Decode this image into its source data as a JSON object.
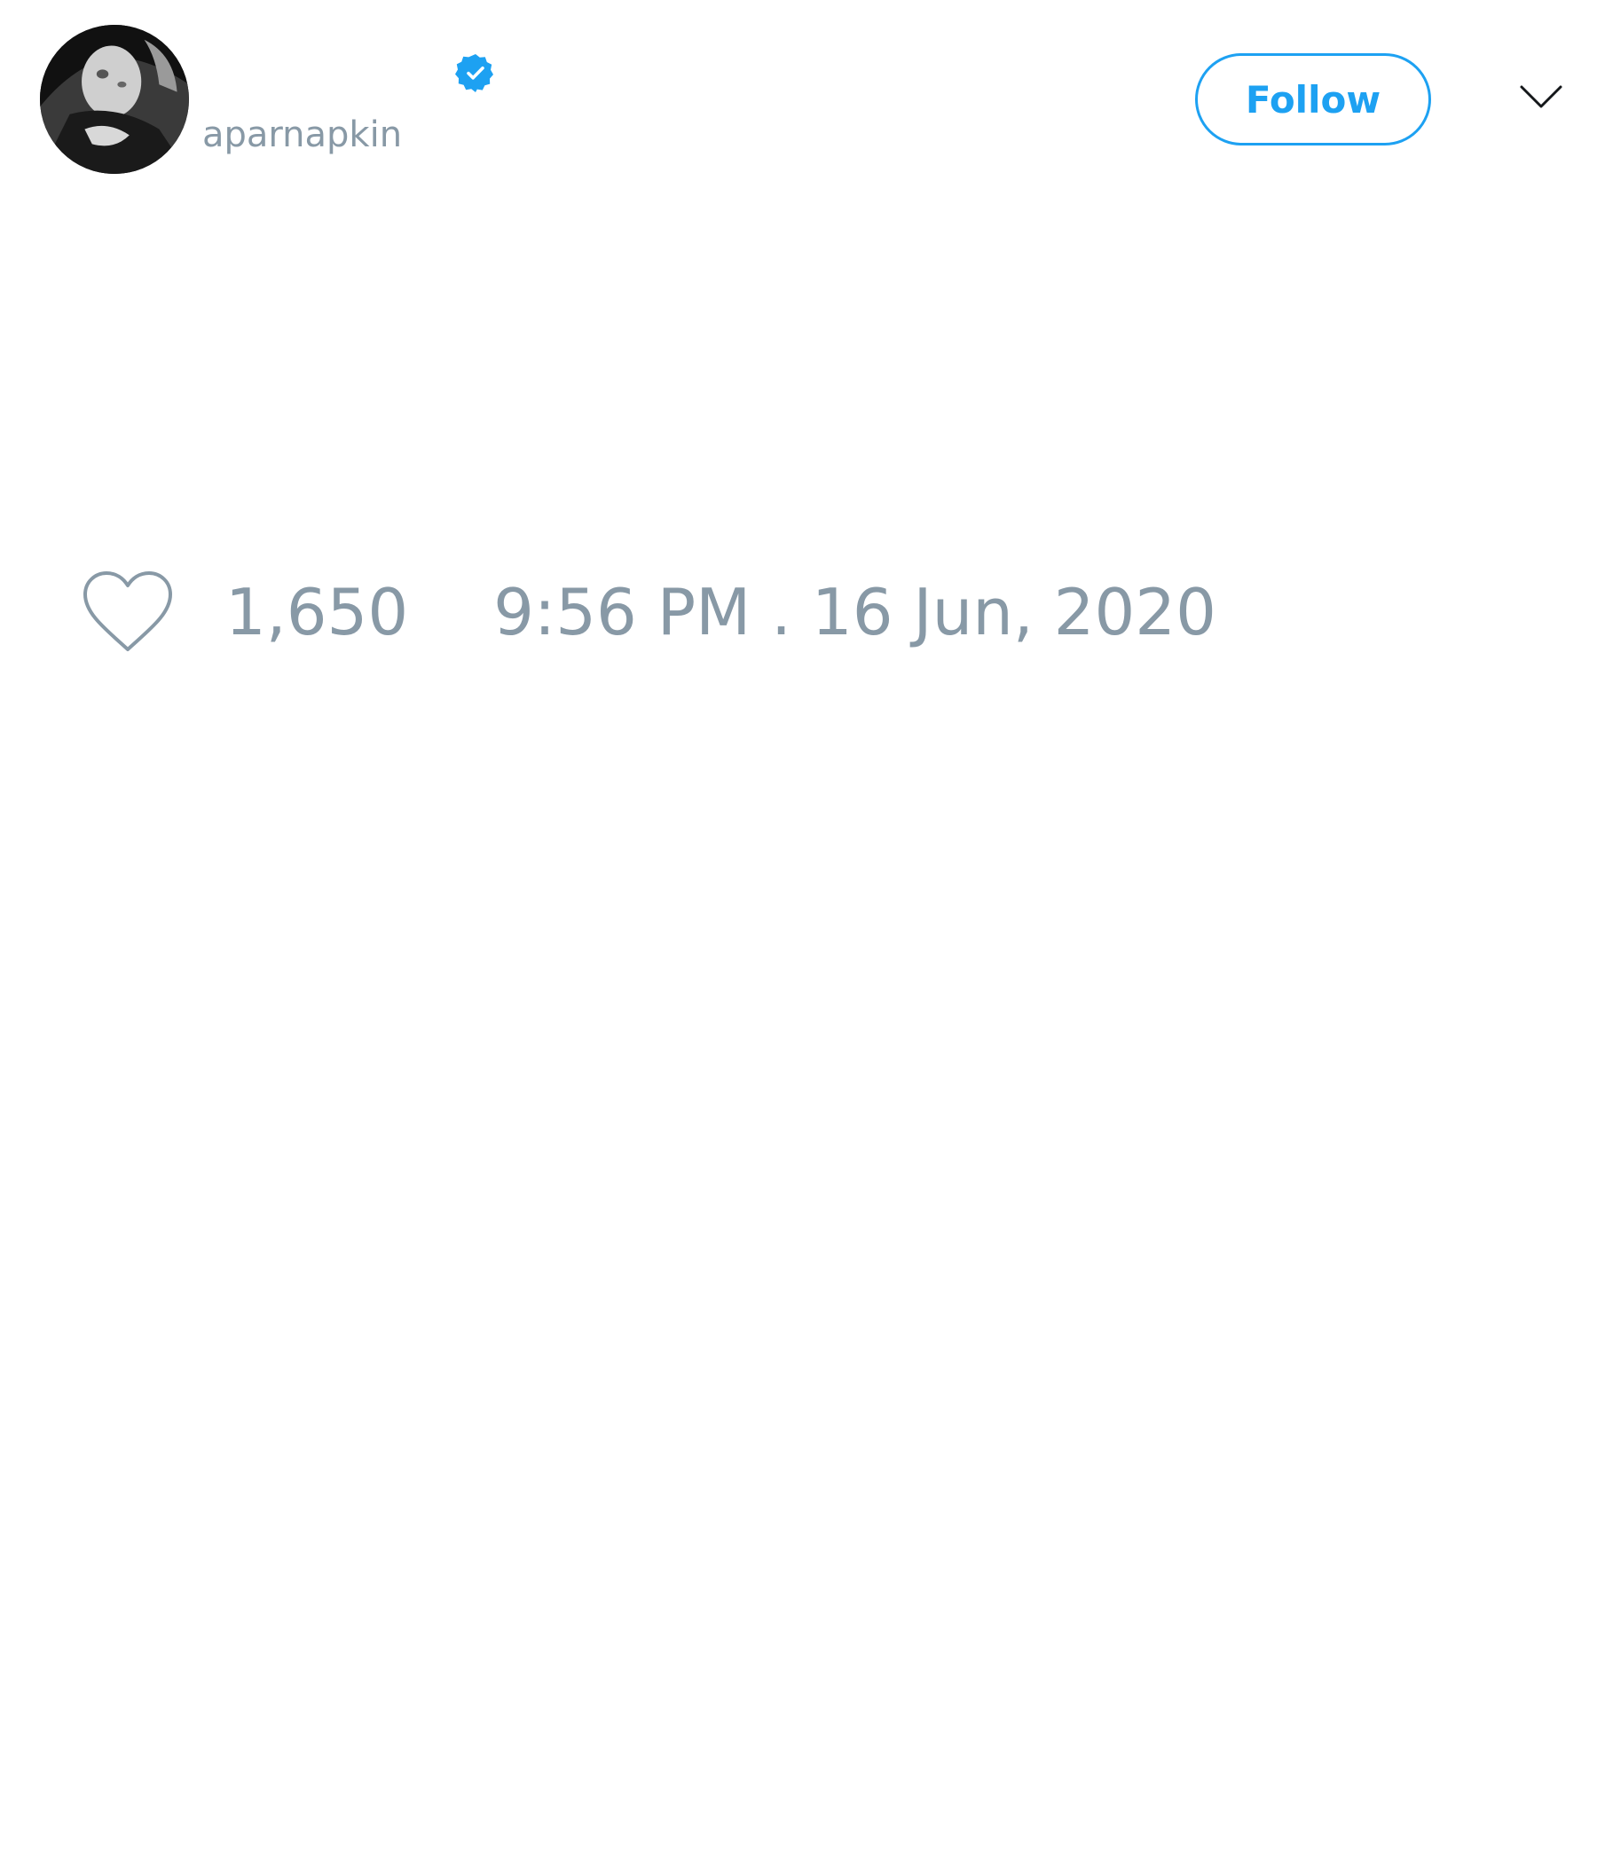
{
  "tweet": {
    "author": {
      "handle": "aparnapkin",
      "verified": true,
      "avatar_icon": "profile-photo"
    },
    "follow_button": {
      "label": "Follow"
    },
    "menu_icon": "chevron-down-icon",
    "like_icon": "heart-icon",
    "like_count": "1,650",
    "timestamp": "9:56 PM . 16 Jun, 2020"
  },
  "colors": {
    "accent": "#1da1f2",
    "muted_text": "#8899a6",
    "background": "#ffffff"
  }
}
